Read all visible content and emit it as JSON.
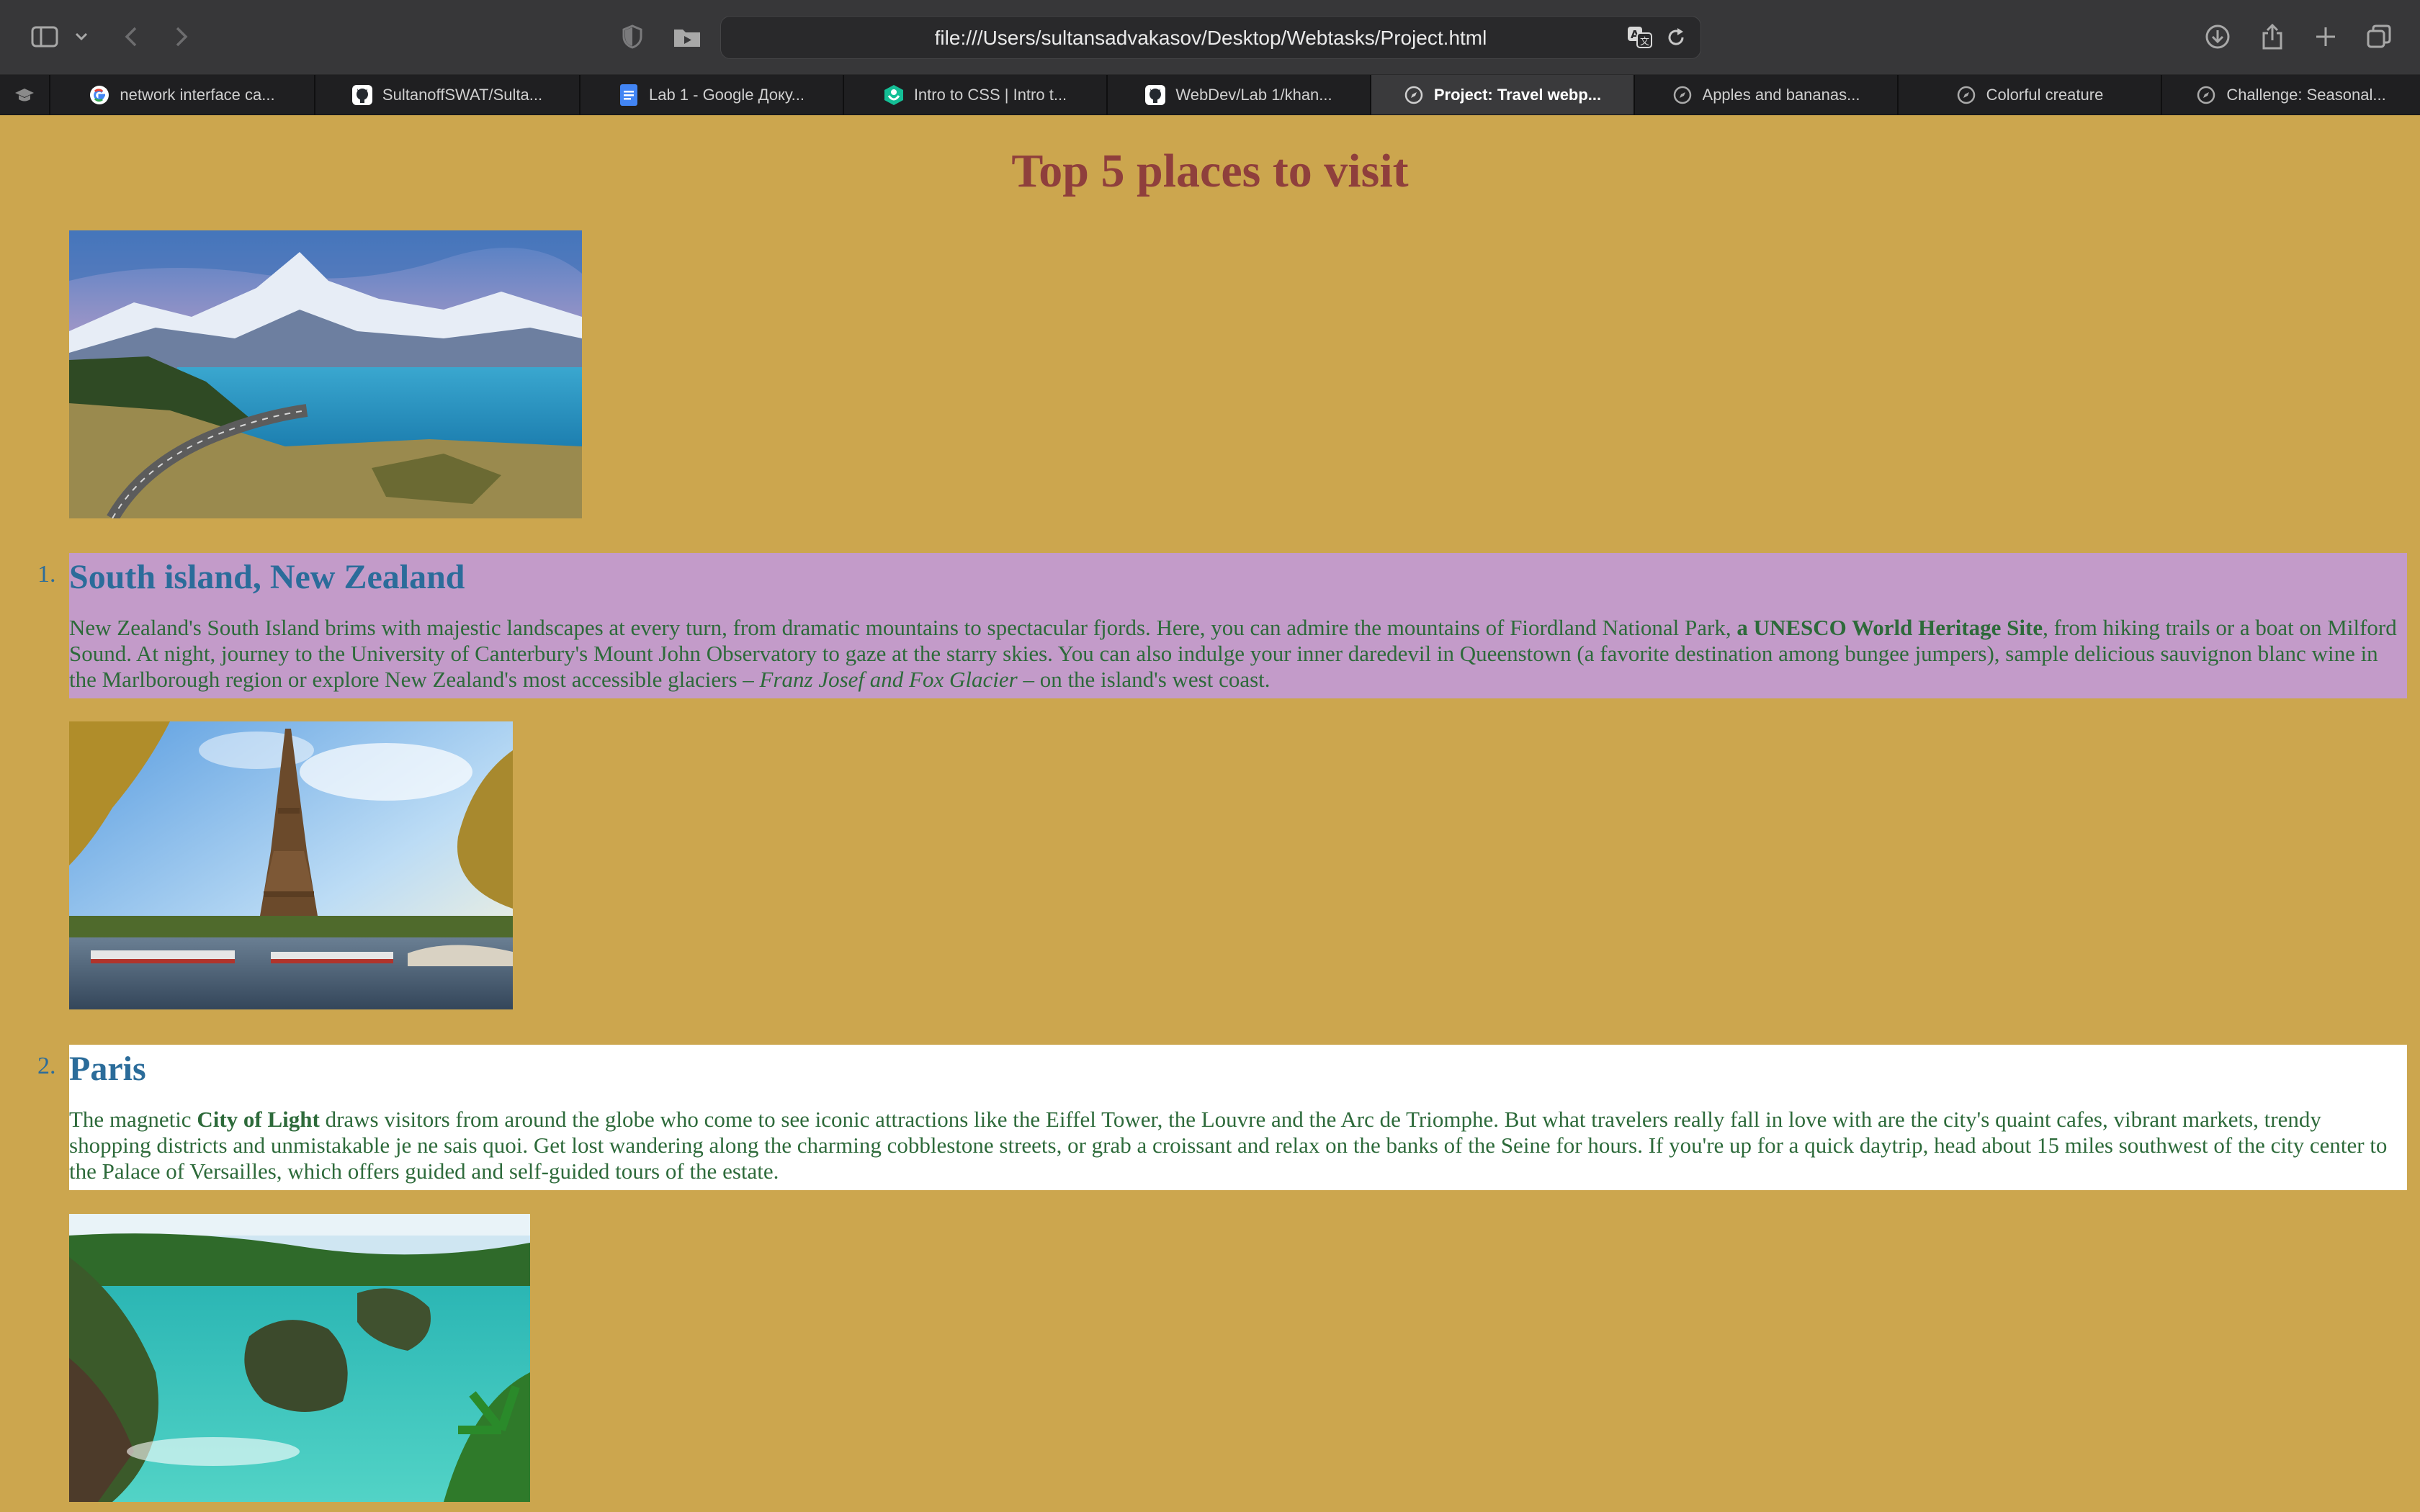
{
  "browser": {
    "url": "file:///Users/sultansadvakasov/Desktop/Webtasks/Project.html",
    "tabs": [
      {
        "label": "network interface ca...",
        "icon": "google-icon"
      },
      {
        "label": "SultanoffSWAT/Sulta...",
        "icon": "github-icon"
      },
      {
        "label": "Lab 1 - Google Доку...",
        "icon": "google-docs-icon"
      },
      {
        "label": "Intro to CSS | Intro t...",
        "icon": "khan-academy-icon"
      },
      {
        "label": "WebDev/Lab 1/khan...",
        "icon": "github-icon"
      },
      {
        "label": "Project: Travel webp...",
        "icon": "compass-icon",
        "active": true
      },
      {
        "label": "Apples and bananas...",
        "icon": "compass-icon"
      },
      {
        "label": "Colorful creature",
        "icon": "compass-icon"
      },
      {
        "label": "Challenge: Seasonal...",
        "icon": "compass-icon"
      }
    ]
  },
  "page": {
    "title": "Top 5 places to visit",
    "items": [
      {
        "number": "1.",
        "heading": "South island, New Zealand",
        "text_1": "New Zealand's South Island brims with majestic landscapes at every turn, from dramatic mountains to spectacular fjords. Here, you can admire the mountains of Fiordland National Park, ",
        "bold": "a UNESCO World Heritage Site",
        "text_2": ", from hiking trails or a boat on Milford Sound. At night, journey to the University of Canterbury's Mount John Observatory to gaze at the starry skies. You can also indulge your inner daredevil in Queenstown (a favorite destination among bungee jumpers), sample delicious sauvignon blanc wine in the Marlborough region or explore New Zealand's most accessible glaciers – ",
        "italic": "Franz Josef and Fox Glacier",
        "text_3": " – on the island's west coast.",
        "highlight": "#c39bc9"
      },
      {
        "number": "2.",
        "heading": "Paris",
        "text_1": "The magnetic ",
        "bold": "City of Light",
        "text_2": " draws visitors from around the globe who come to see iconic attractions like the Eiffel Tower, the Louvre and the Arc de Triomphe. But what travelers really fall in love with are the city's quaint cafes, vibrant markets, trendy shopping districts and unmistakable je ne sais quoi. Get lost wandering along the charming cobblestone streets, or grab a croissant and relax on the banks of the Seine for hours. If you're up for a quick daytrip, head about 15 miles southwest of the city center to the Palace of Versailles, which offers guided and self-guided tours of the estate.",
        "highlight": "#ffffff"
      }
    ]
  },
  "colors": {
    "background": "#cca64e",
    "title": "#8f3f3c",
    "heading": "#2b6c9a",
    "body_text": "#2d6a3a"
  }
}
